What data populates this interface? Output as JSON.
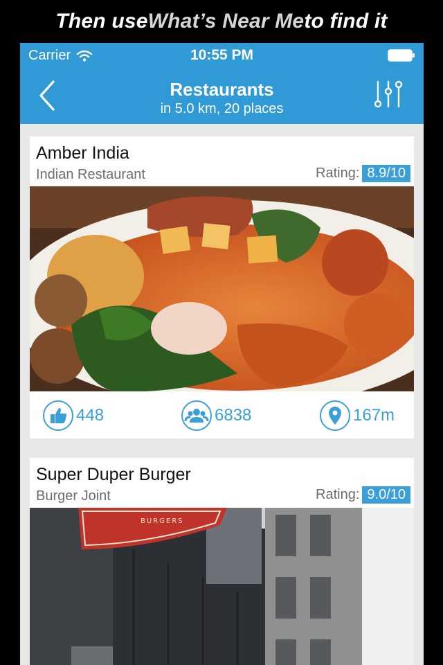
{
  "banner": {
    "prefix": "Then use ",
    "highlight": "What’s Near Me",
    "suffix": " to find it"
  },
  "status": {
    "carrier": "Carrier",
    "time": "10:55 PM"
  },
  "nav": {
    "title": "Restaurants",
    "subtitle": "in 5.0 km, 20 places"
  },
  "places": [
    {
      "name": "Amber India",
      "category": "Indian Restaurant",
      "rating_label": "Rating:",
      "rating": "8.9/10",
      "likes": "448",
      "checkins": "6838",
      "distance": "167m"
    },
    {
      "name": "Super Duper Burger",
      "category": "Burger Joint",
      "rating_label": "Rating:",
      "rating": "9.0/10",
      "sign_text": "BURGERS"
    }
  ],
  "colors": {
    "accent": "#2f9ad6",
    "badge": "#3a9fd8",
    "page_bg": "#e8e8e8"
  },
  "icons": [
    "back-chevron-icon",
    "filter-sliders-icon",
    "wifi-icon",
    "battery-icon",
    "thumbs-up-icon",
    "people-icon",
    "location-pin-icon"
  ]
}
